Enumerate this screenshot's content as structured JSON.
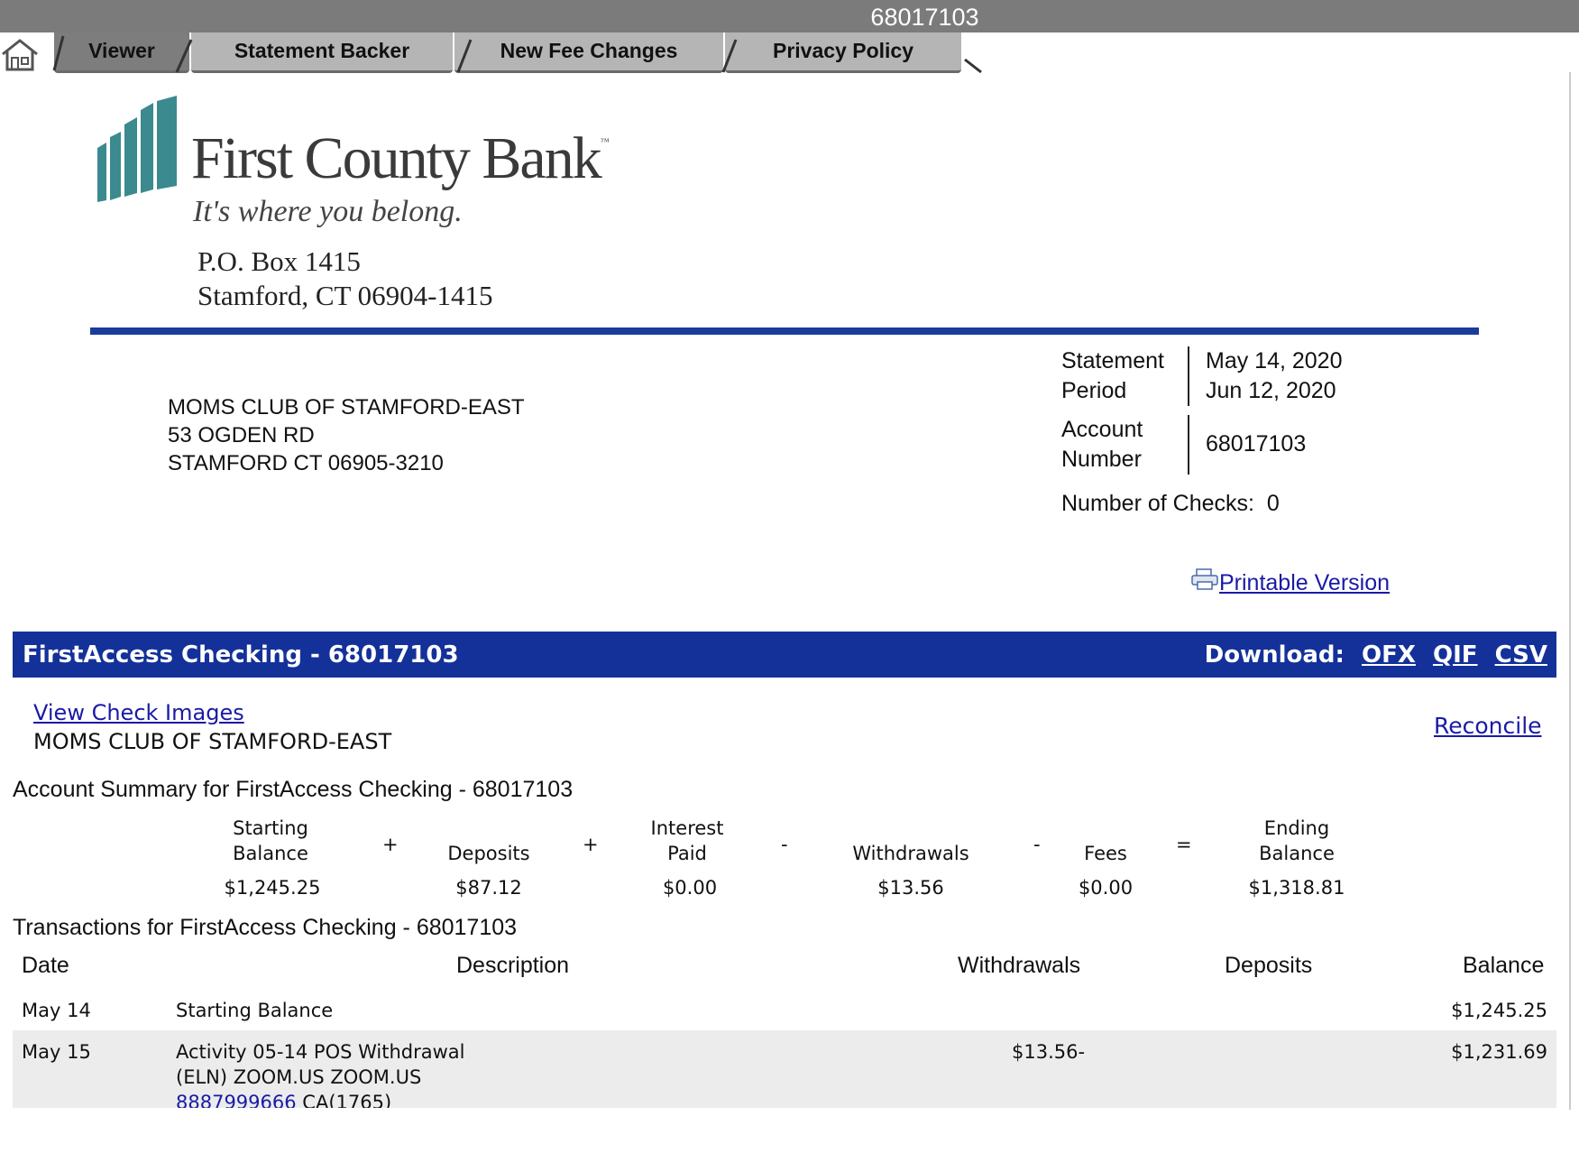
{
  "window": {
    "title": "68017103"
  },
  "tabs": [
    {
      "label": "Viewer",
      "active": true
    },
    {
      "label": "Statement Backer"
    },
    {
      "label": "New Fee Changes"
    },
    {
      "label": "Privacy Policy"
    }
  ],
  "bank": {
    "name": "First County Bank",
    "trademark": "™",
    "tagline": "It's where you belong.",
    "address_line1": "P.O. Box 1415",
    "address_line2": "Stamford, CT  06904-1415",
    "logo_color": "#3a8a8f"
  },
  "customer": {
    "name": "MOMS CLUB OF STAMFORD-EAST",
    "street": "53 OGDEN RD",
    "city": "STAMFORD CT 06905-3210"
  },
  "statement": {
    "period_label_1": "Statement",
    "period_label_2": "Period",
    "period_start": "May 14, 2020",
    "period_end": "Jun 12, 2020",
    "account_label_1": "Account",
    "account_label_2": "Number",
    "account_number": "68017103",
    "checks_label": "Number of Checks:",
    "checks_value": "0"
  },
  "links": {
    "printable": "Printable Version",
    "view_check_images": "View Check Images",
    "reconcile": "Reconcile"
  },
  "account_bar": {
    "title": "FirstAccess Checking - 68017103",
    "download_label": "Download:",
    "formats": [
      "OFX",
      "QIF",
      "CSV"
    ],
    "color": "#14319a"
  },
  "summary": {
    "title": "Account Summary for FirstAccess Checking - 68017103",
    "starting_label_1": "Starting",
    "starting_label_2": "Balance",
    "starting_value": "$1,245.25",
    "deposits_label": "Deposits",
    "deposits_value": "$87.12",
    "interest_label_1": "Interest",
    "interest_label_2": "Paid",
    "interest_value": "$0.00",
    "withdrawals_label": "Withdrawals",
    "withdrawals_value": "$13.56",
    "fees_label": "Fees",
    "fees_value": "$0.00",
    "ending_label_1": "Ending",
    "ending_label_2": "Balance",
    "ending_value": "$1,318.81",
    "ops": [
      "+",
      "+",
      "-",
      "-",
      "="
    ]
  },
  "transactions": {
    "title": "Transactions for FirstAccess Checking - 68017103",
    "headers": {
      "date": "Date",
      "description": "Description",
      "withdrawals": "Withdrawals",
      "deposits": "Deposits",
      "balance": "Balance"
    },
    "rows": [
      {
        "date": "May 14",
        "description_1": "Starting Balance",
        "withdrawal": "",
        "deposit": "",
        "balance": "$1,245.25"
      },
      {
        "date": "May 15",
        "description_1": "Activity 05-14 POS Withdrawal",
        "description_2": "(ELN) ZOOM.US ZOOM.US",
        "description_3_link": "8887999666",
        "description_3_rest": " CA(1765)",
        "withdrawal": "$13.56-",
        "deposit": "",
        "balance": "$1,231.69"
      }
    ]
  }
}
